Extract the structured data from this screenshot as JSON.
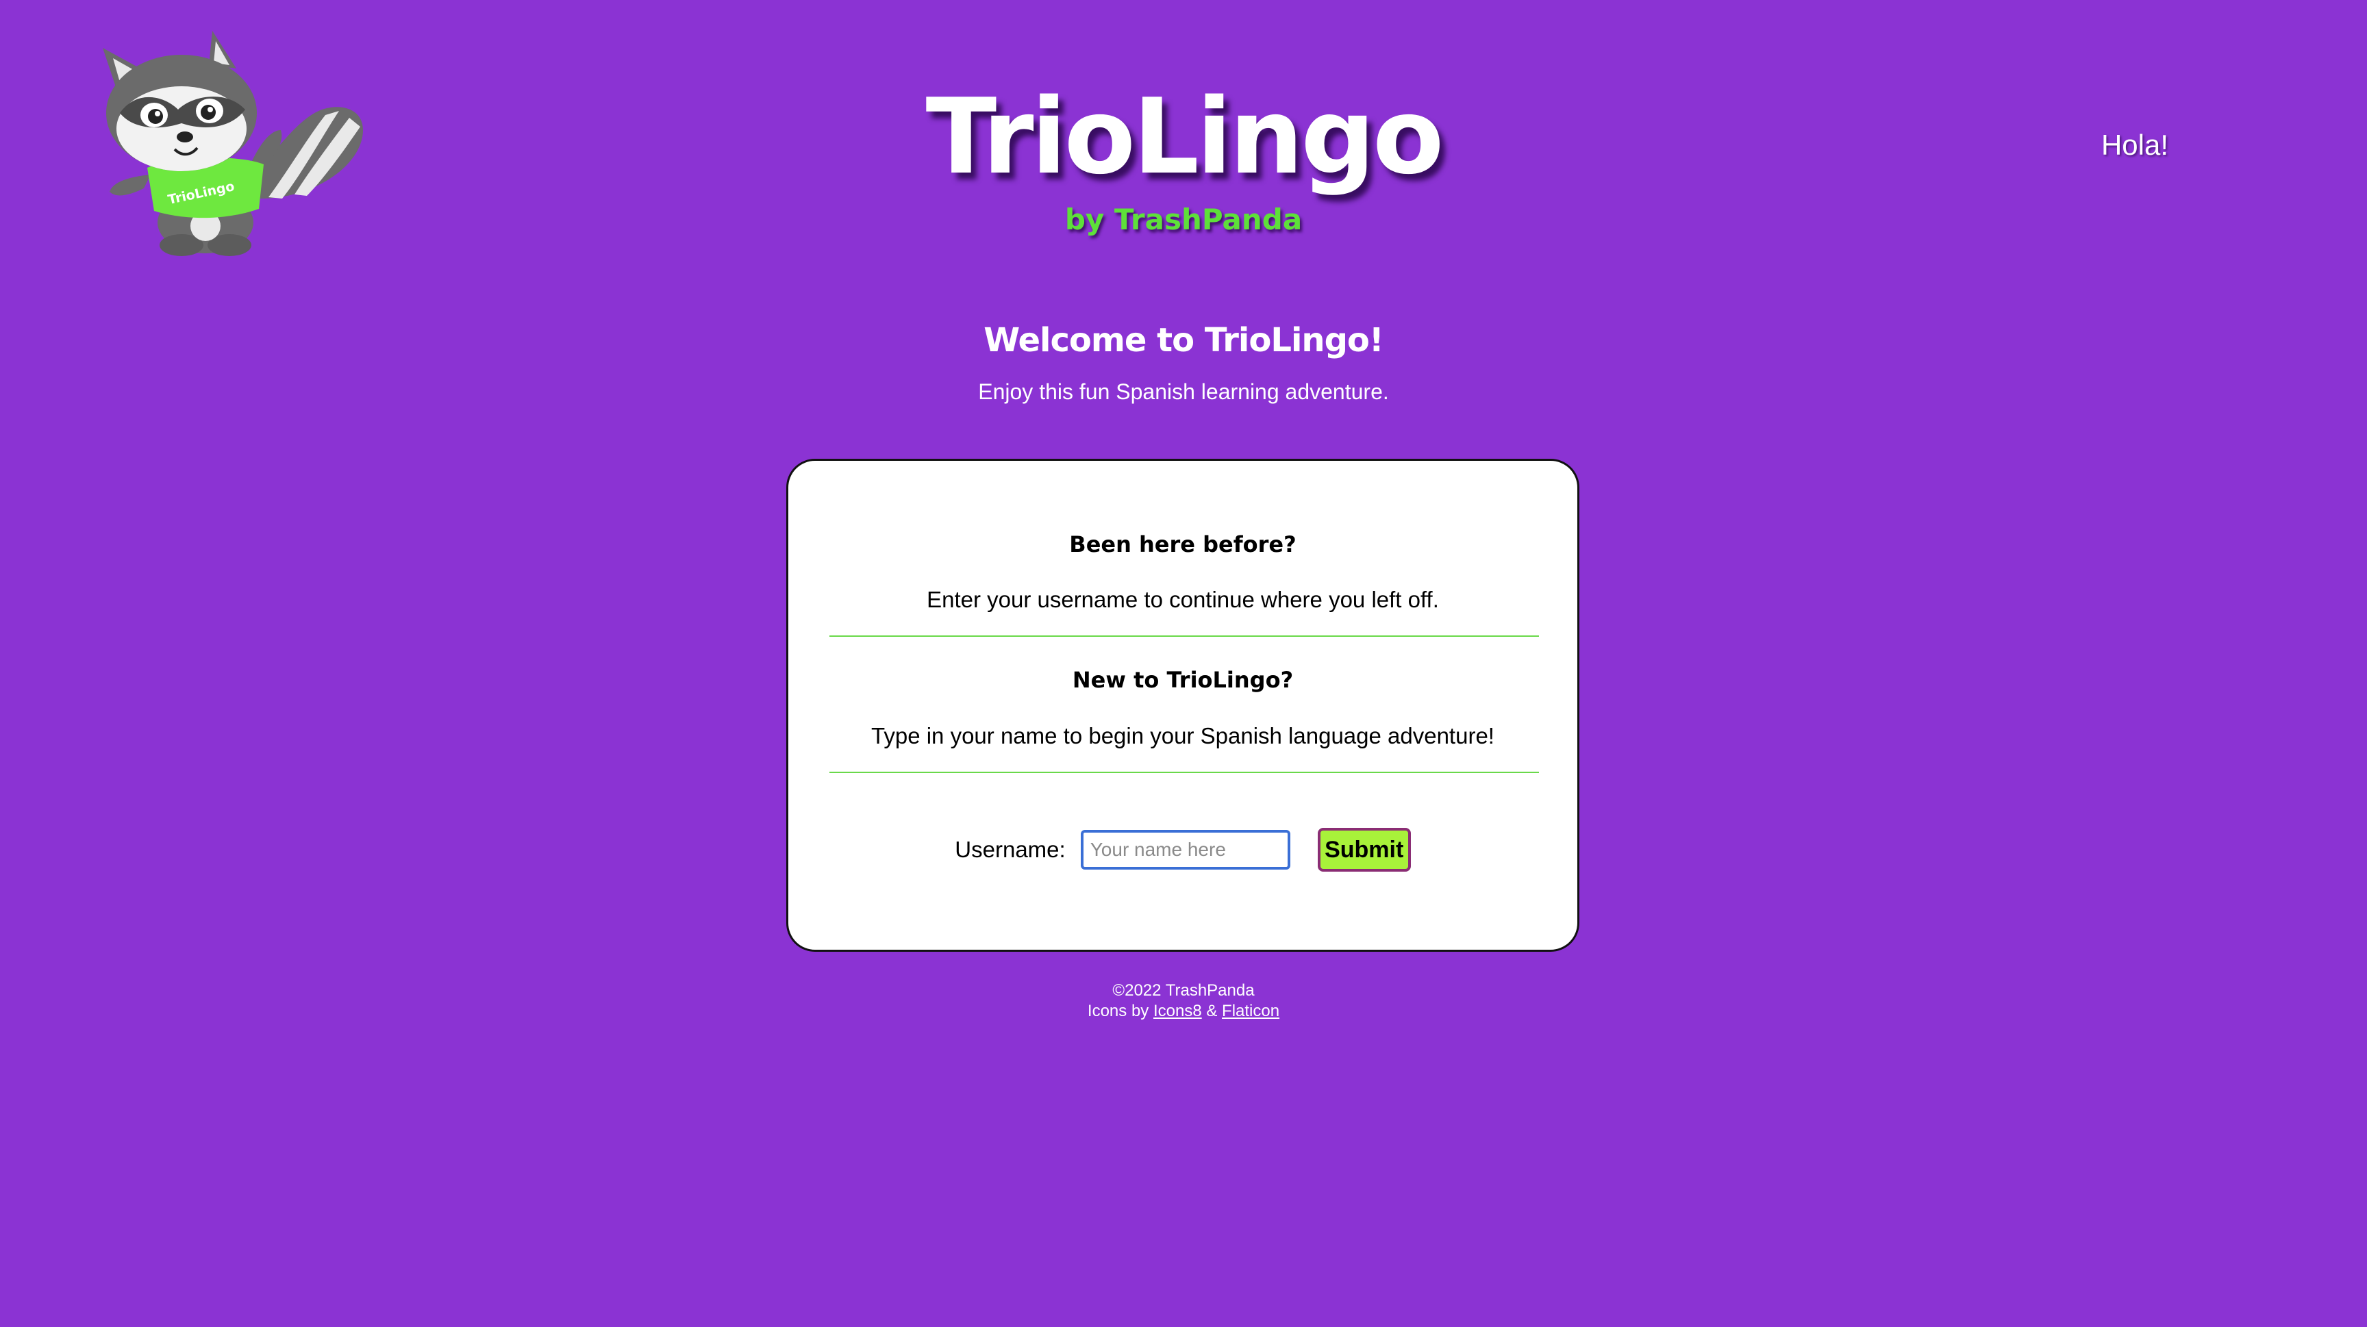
{
  "header": {
    "title": "TrioLingo",
    "subtitle": "by TrashPanda",
    "greeting": "Hola!",
    "mascot_shirt_text": "TrioLingo"
  },
  "welcome": {
    "title": "Welcome to TrioLingo!",
    "subtitle": "Enjoy this fun Spanish learning adventure."
  },
  "card": {
    "returning_heading": "Been here before?",
    "returning_text": "Enter your username to continue where you left off.",
    "new_heading": "New to TrioLingo?",
    "new_text": "Type in your name to begin your Spanish language adventure!",
    "username_label": "Username:",
    "username_placeholder": "Your name here",
    "username_value": "",
    "submit_label": "Submit"
  },
  "footer": {
    "copyright": "©2022 TrashPanda",
    "icons_prefix": "Icons by",
    "icons8_link": "Icons8",
    "separator": "&",
    "flaticon_link": "Flaticon"
  },
  "colors": {
    "background": "#8b33d3",
    "accent_green": "#5ee03a",
    "button_green": "#a8f23a",
    "divider_green": "#6ad94a",
    "input_border": "#3a6fd6"
  }
}
